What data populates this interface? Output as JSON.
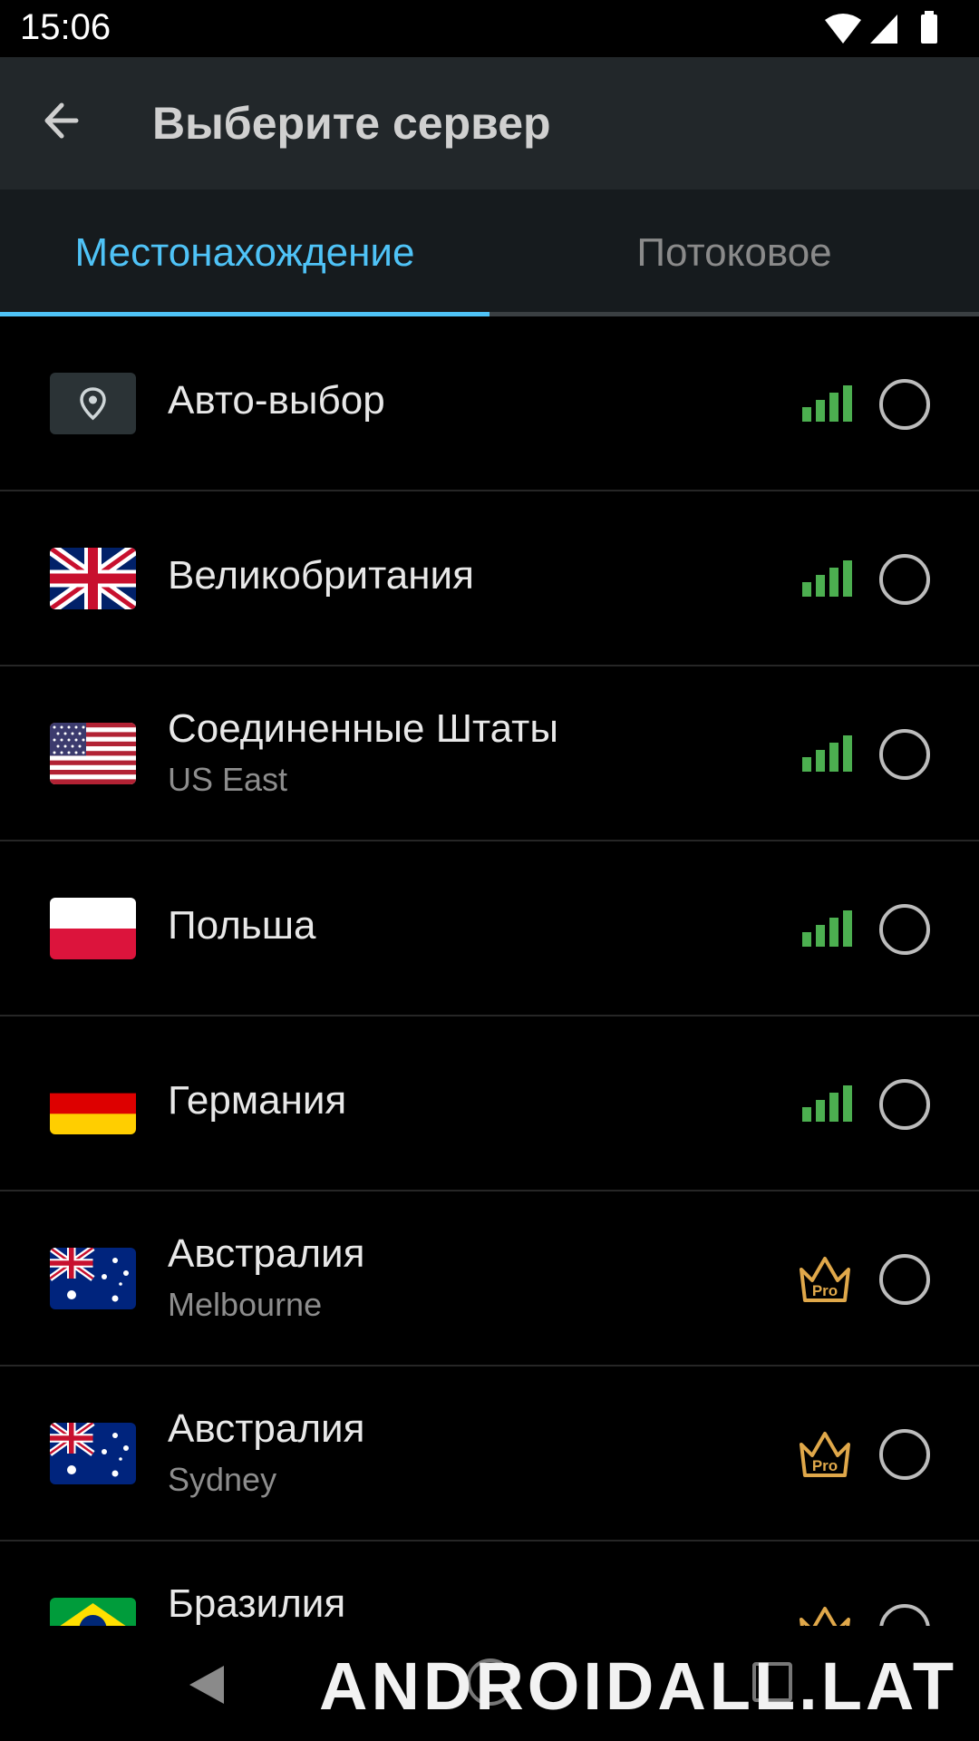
{
  "status_bar": {
    "time": "15:06"
  },
  "app_bar": {
    "title": "Выберите сервер"
  },
  "tabs": [
    {
      "label": "Местонахождение",
      "selected": true
    },
    {
      "label": "Потоковое",
      "selected": false
    }
  ],
  "colors": {
    "accent": "#4fc3f7",
    "signal": "#4caf50",
    "pro_badge": "#e0a84a",
    "background": "#000000",
    "app_bar": "#22272a"
  },
  "servers": [
    {
      "name": "Авто-выбор",
      "subtitle": "",
      "flag": "location-pin-icon",
      "badge": "signal-icon",
      "selected": false
    },
    {
      "name": "Великобритания",
      "subtitle": "",
      "flag": "uk-flag-icon",
      "badge": "signal-icon",
      "selected": false
    },
    {
      "name": "Соединенные Штаты",
      "subtitle": "US East",
      "flag": "us-flag-icon",
      "badge": "signal-icon",
      "selected": false
    },
    {
      "name": "Польша",
      "subtitle": "",
      "flag": "poland-flag-icon",
      "badge": "signal-icon",
      "selected": false
    },
    {
      "name": "Германия",
      "subtitle": "",
      "flag": "germany-flag-icon",
      "badge": "signal-icon",
      "selected": false
    },
    {
      "name": "Австралия",
      "subtitle": "Melbourne",
      "flag": "australia-flag-icon",
      "badge": "pro-crown-icon",
      "badge_text": "Pro",
      "selected": false
    },
    {
      "name": "Австралия",
      "subtitle": "Sydney",
      "flag": "australia-flag-icon",
      "badge": "pro-crown-icon",
      "badge_text": "Pro",
      "selected": false
    },
    {
      "name": "Бразилия",
      "subtitle": "",
      "flag": "brazil-flag-icon",
      "badge": "pro-crown-icon",
      "badge_text": "",
      "selected": false
    }
  ],
  "watermark": "ANDROIDALL.LAT"
}
